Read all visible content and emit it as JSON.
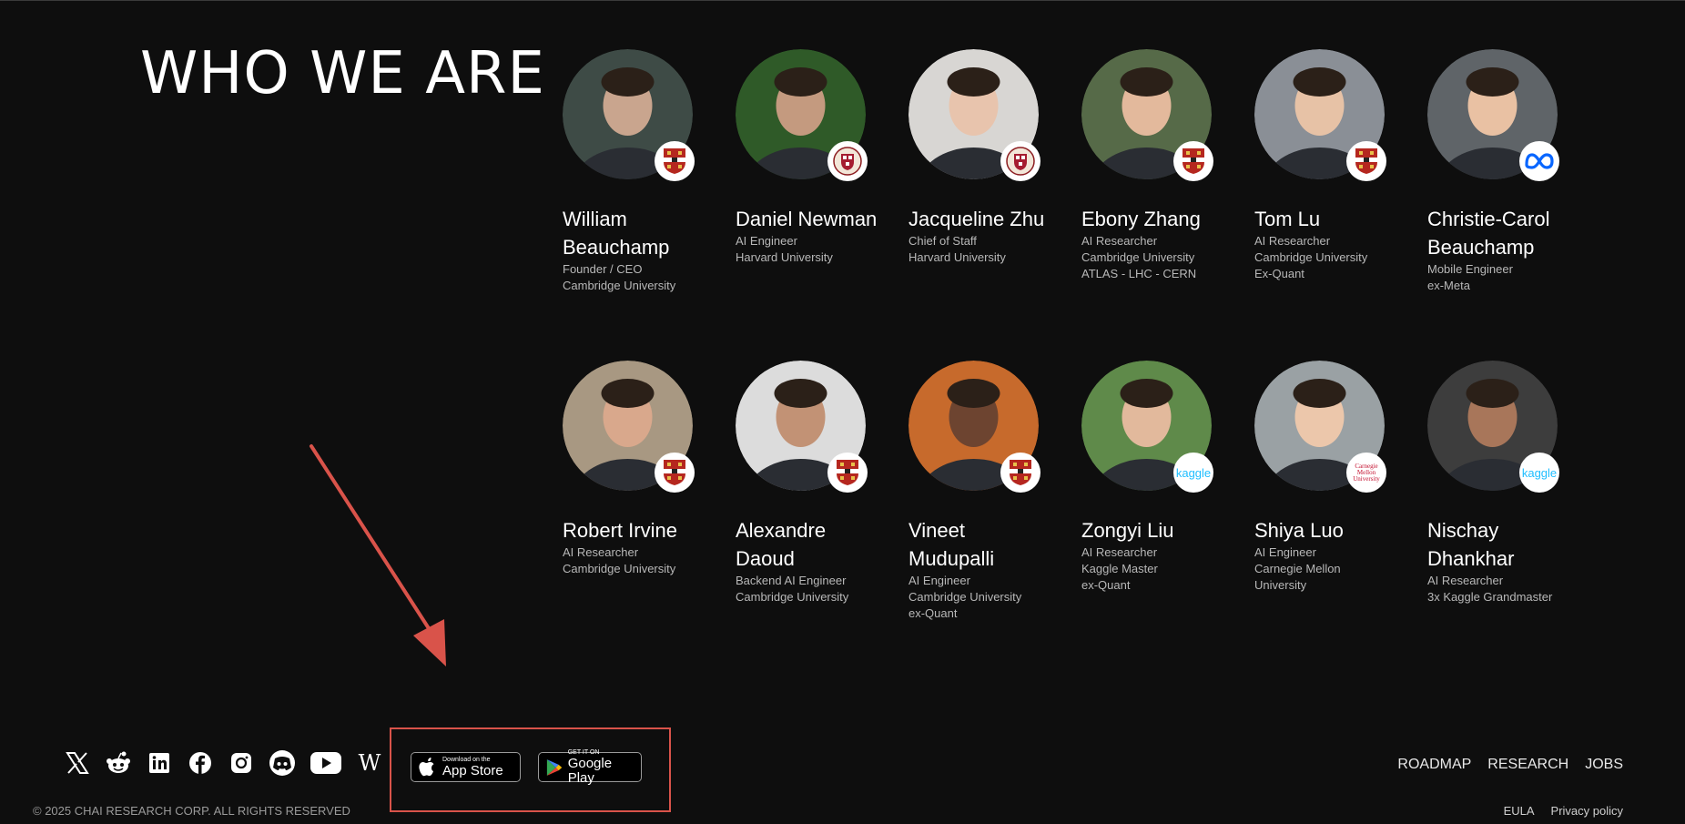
{
  "section": {
    "title": "WHO WE ARE"
  },
  "team": [
    {
      "name": "William Beauchamp",
      "lines": [
        "Founder / CEO",
        "Cambridge University"
      ],
      "badge": "cambridge-crest"
    },
    {
      "name": "Daniel Newman",
      "lines": [
        "AI Engineer",
        "Harvard University"
      ],
      "badge": "harvard-crest"
    },
    {
      "name": "Jacqueline Zhu",
      "lines": [
        "Chief of Staff",
        "Harvard University"
      ],
      "badge": "harvard-crest"
    },
    {
      "name": "Ebony Zhang",
      "lines": [
        "AI Researcher",
        "Cambridge University",
        "ATLAS - LHC - CERN"
      ],
      "badge": "cambridge-crest"
    },
    {
      "name": "Tom Lu",
      "lines": [
        "AI Researcher",
        "Cambridge University",
        "Ex-Quant"
      ],
      "badge": "cambridge-crest"
    },
    {
      "name": "Christie-Carol Beauchamp",
      "lines": [
        "Mobile Engineer",
        "ex-Meta"
      ],
      "badge": "meta-logo"
    },
    {
      "name": "Robert Irvine",
      "lines": [
        "AI Researcher",
        "Cambridge University"
      ],
      "badge": "cambridge-crest"
    },
    {
      "name": "Alexandre Daoud",
      "lines": [
        "Backend AI Engineer",
        "Cambridge University"
      ],
      "badge": "cambridge-crest"
    },
    {
      "name": "Vineet Mudupalli",
      "lines": [
        "AI Engineer",
        "Cambridge University",
        "ex-Quant"
      ],
      "badge": "cambridge-crest"
    },
    {
      "name": "Zongyi Liu",
      "lines": [
        "AI Researcher",
        "Kaggle Master",
        "ex-Quant"
      ],
      "badge": "kaggle-logo"
    },
    {
      "name": "Shiya Luo",
      "lines": [
        "AI Engineer",
        "Carnegie Mellon",
        "University"
      ],
      "badge": "cmu-logo"
    },
    {
      "name": "Nischay Dhankhar",
      "lines": [
        "AI Researcher",
        "3x Kaggle Grandmaster"
      ],
      "badge": "kaggle-logo"
    }
  ],
  "badge_text": {
    "kaggle": "kaggle",
    "cmu": "Carnegie Mellon University"
  },
  "socials": [
    "x-icon",
    "reddit-icon",
    "linkedin-icon",
    "facebook-icon",
    "instagram-icon",
    "discord-icon",
    "youtube-icon",
    "wikipedia-icon"
  ],
  "wiki_glyph": "W",
  "stores": {
    "apple": {
      "small": "Download on the",
      "big": "App Store"
    },
    "google": {
      "small": "GET IT ON",
      "big": "Google Play"
    }
  },
  "footer": {
    "links": [
      "ROADMAP",
      "RESEARCH",
      "JOBS"
    ],
    "copyright": "© 2025 CHAI RESEARCH CORP. ALL RIGHTS RESERVED",
    "legal": [
      "EULA",
      "Privacy policy"
    ]
  },
  "colors": {
    "background": "#0e0e0e",
    "annotation": "#d9534a",
    "kaggle": "#20beff",
    "meta": "#0866ff",
    "cambridge": "#b5271f"
  }
}
